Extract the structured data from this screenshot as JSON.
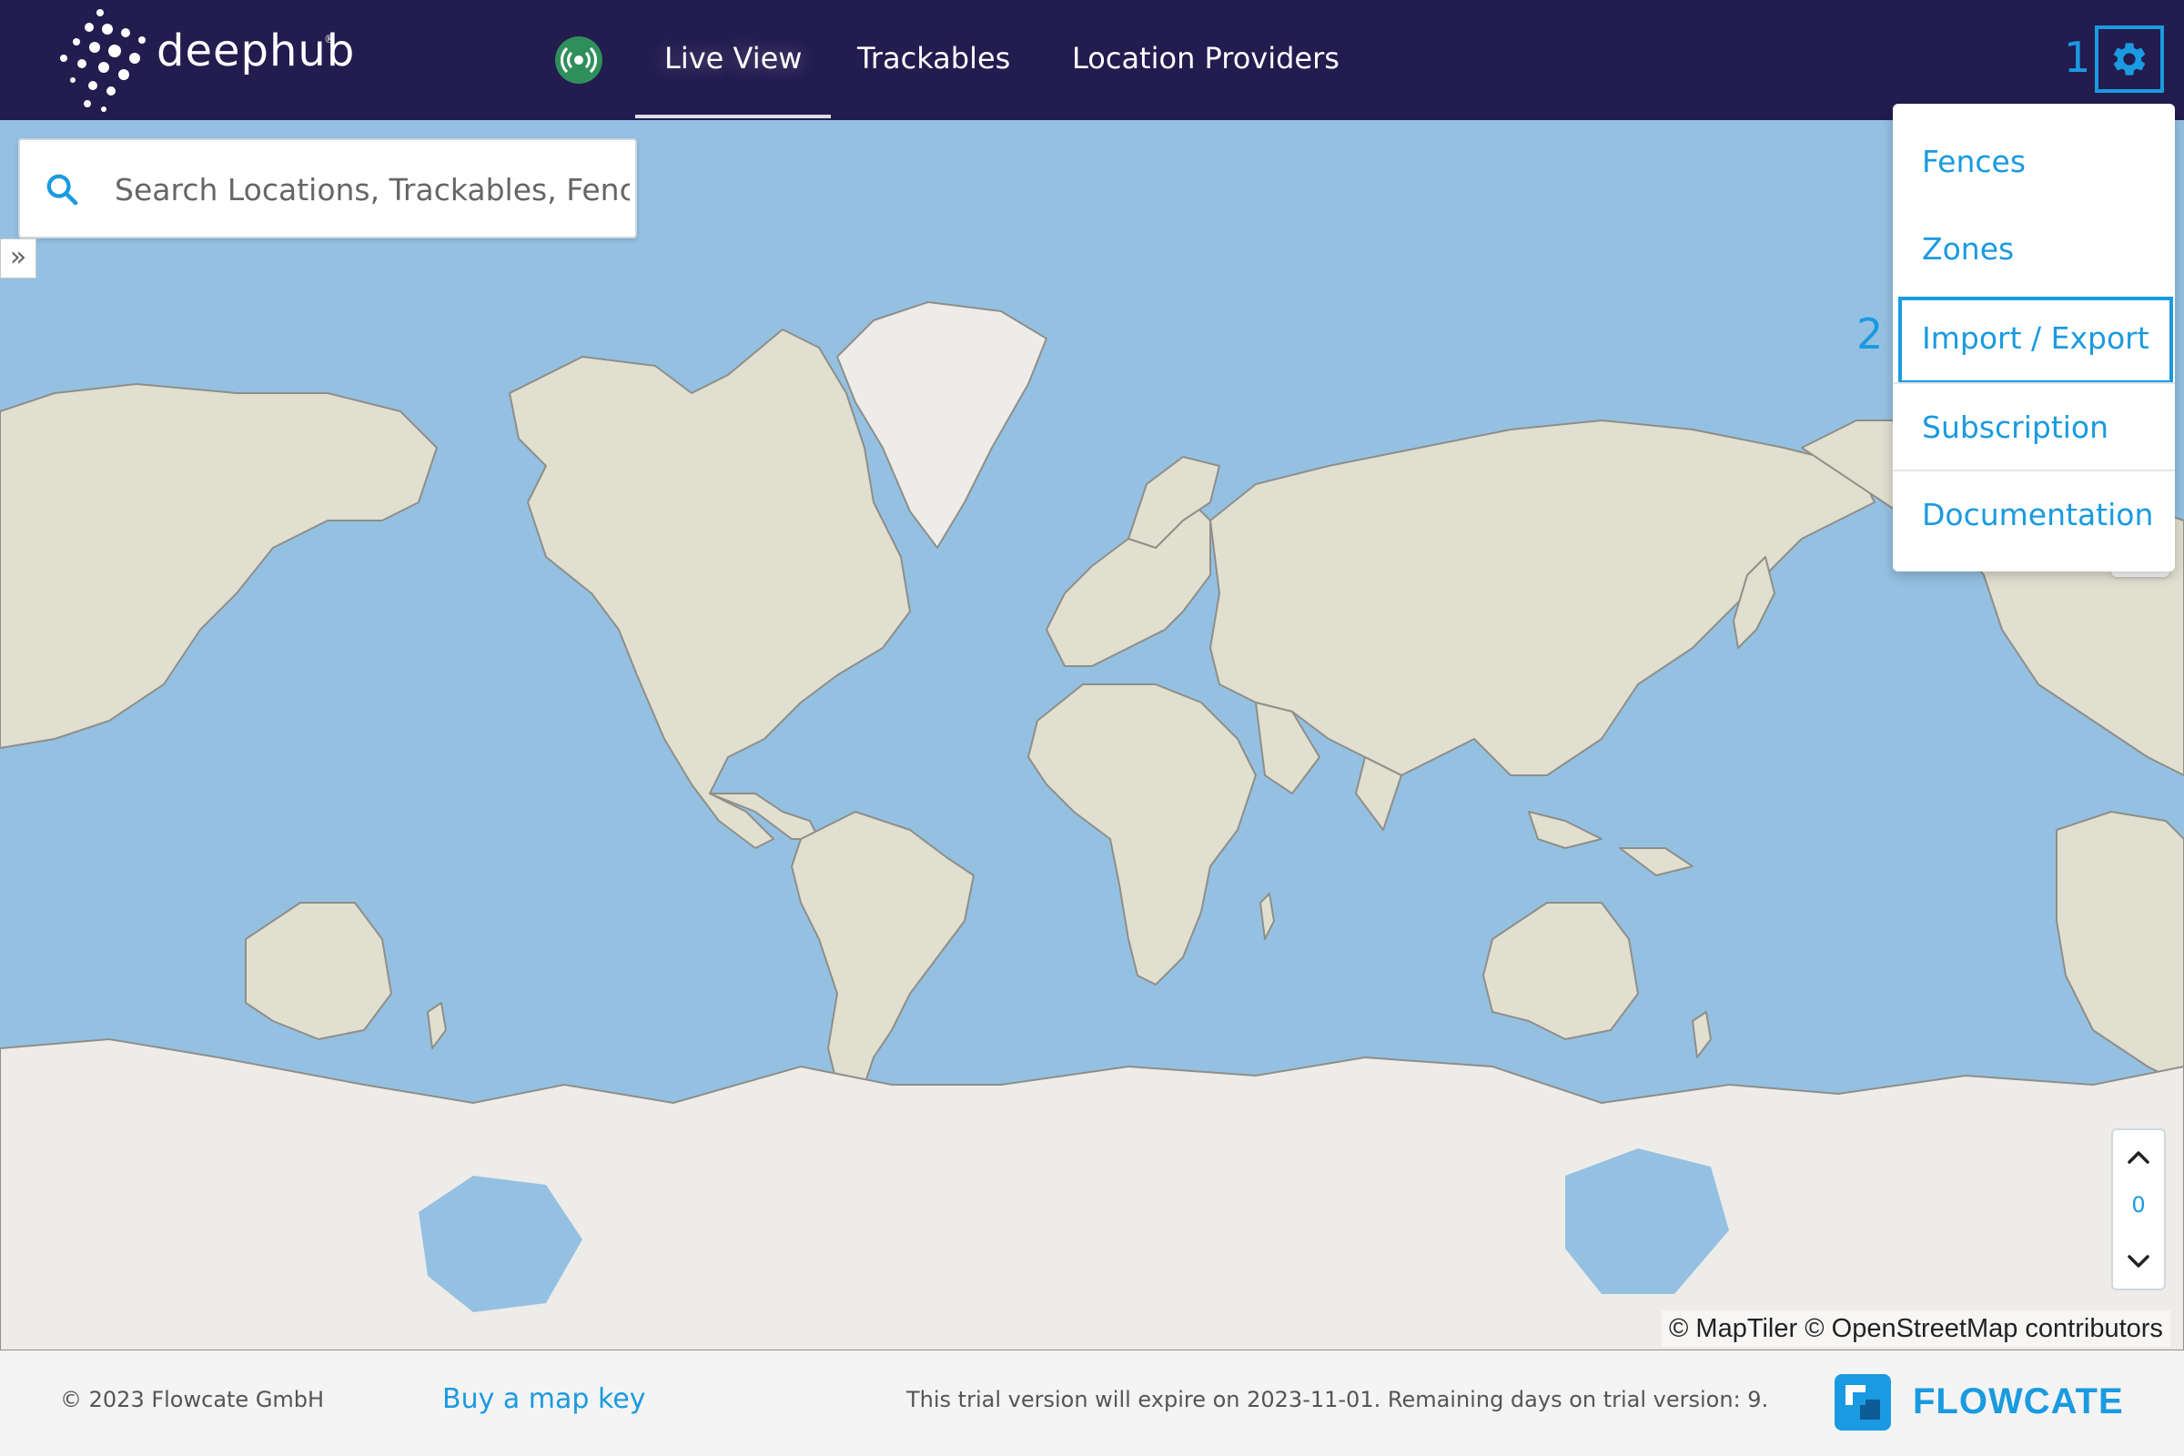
{
  "header": {
    "brand": "deephub",
    "brand_mark": "®",
    "status_icon": "live-broadcast-icon",
    "tabs": [
      {
        "label": "Live View",
        "active": true
      },
      {
        "label": "Trackables",
        "active": false
      },
      {
        "label": "Location Providers",
        "active": false
      }
    ],
    "settings_icon": "gear-icon",
    "annotation_1": "1"
  },
  "search": {
    "placeholder": "Search Locations, Trackables, Fences, Zones",
    "icon": "search-icon"
  },
  "sidebar_toggle": "»",
  "settings_menu": {
    "annotation_2": "2",
    "items": [
      {
        "label": "Fences"
      },
      {
        "label": "Zones"
      },
      {
        "label": "Import / Export",
        "highlighted": true
      },
      {
        "label": "Subscription"
      },
      {
        "label": "Documentation"
      }
    ]
  },
  "level_control": {
    "value": "0",
    "up_icon": "chevron-up-icon",
    "down_icon": "chevron-down-icon"
  },
  "map": {
    "attribution": "© MapTiler © OpenStreetMap contributors",
    "colors": {
      "water": "#94c1e2",
      "land": "#e0dfd0",
      "ice": "#eeece8",
      "border": "#8f8e88"
    }
  },
  "footer": {
    "copyright": "© 2023 Flowcate GmbH",
    "buy_key_link": "Buy a map key",
    "trial_notice": "This trial version will expire on 2023-11-01. Remaining days on trial version: 9.",
    "company_logo": "FLOWCATE"
  },
  "colors": {
    "header_bg": "#231c4f",
    "accent": "#1a9ae0",
    "live_status": "#2f8f5b"
  }
}
